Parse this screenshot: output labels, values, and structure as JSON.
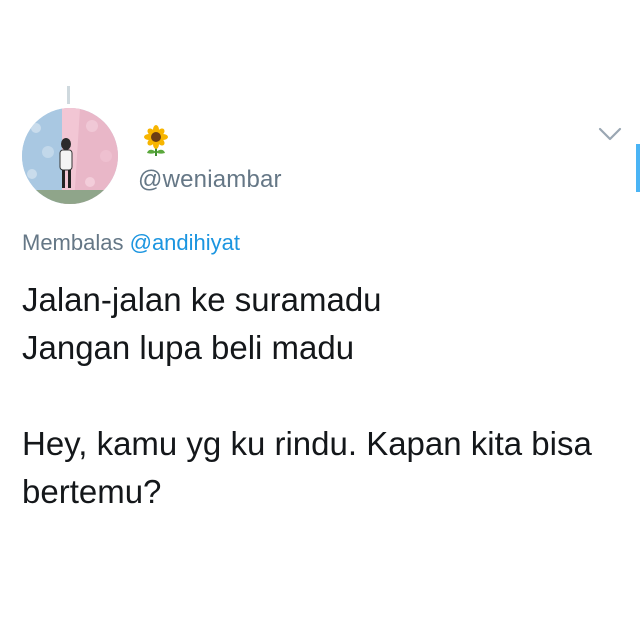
{
  "tweet": {
    "author_name_icon": "sunflower-emoji",
    "handle": "@weniambar",
    "reply_prefix": "Membalas",
    "reply_mention": "@andihiyat",
    "lines": [
      "Jalan-jalan ke suramadu",
      "Jangan lupa beli madu",
      "Hey, kamu yg ku rindu. Kapan kita bisa bertemu?"
    ],
    "menu_icon": "chevron-down-icon"
  },
  "colors": {
    "text": "#14171a",
    "secondary": "#657786",
    "link": "#1b95e0",
    "accent": "#1da1f2"
  }
}
